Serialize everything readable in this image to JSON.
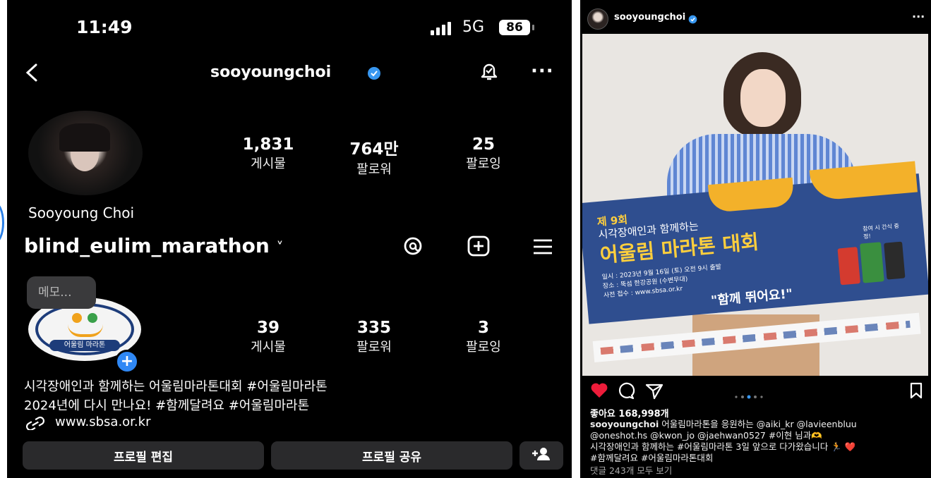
{
  "left": {
    "status": {
      "time": "11:49",
      "network": "5G",
      "battery": "86"
    },
    "header": {
      "username": "sooyoungchoi"
    },
    "profile1": {
      "display_name": "Sooyoung Choi",
      "stats": [
        {
          "value": "1,831",
          "label": "게시물"
        },
        {
          "value": "764만",
          "label": "팔로워"
        },
        {
          "value": "25",
          "label": "팔로잉"
        }
      ]
    },
    "account_switch": {
      "name": "blind_eulim_marathon",
      "chevron": "˅"
    },
    "memo_bubble": "메모...",
    "profile2": {
      "logo_text": "어울림 마라톤",
      "stats": [
        {
          "value": "39",
          "label": "게시물"
        },
        {
          "value": "335",
          "label": "팔로워"
        },
        {
          "value": "3",
          "label": "팔로잉"
        }
      ],
      "bio_line1": "시각장애인과 함께하는 어울림마라톤대회 #어울림마라톤",
      "bio_line2": "2024년에 다시 만나요! #함께달려요 #어울림마라톤",
      "link": "www.sbsa.or.kr"
    },
    "buttons": {
      "edit": "프로필 편집",
      "share": "프로필 공유"
    }
  },
  "right": {
    "username": "sooyoungchoi",
    "more": "···",
    "poster": {
      "edition": "제 9회",
      "subtitle": "시각장애인과 함께하는",
      "title": "어울림 마라톤 대회",
      "date_line": "일시 : 2023년 9월 16일 (토) 오전 9시 출발",
      "place_line": "장소 : 뚝섬 한강공원 (수변무대)",
      "reg_line": "사전 접수 : www.sbsa.or.kr",
      "slogan": "\"함께 뛰어요!\"",
      "gift_note": "참여 시 간식 증정!"
    },
    "likes": "좋아요 168,998개",
    "caption_user": "sooyoungchoi",
    "caption_line1": "어울림마라톤을 응원하는 @aiki_kr @lavieenbluu",
    "caption_line2": "@oneshot.hs @kwon_jo @jaehwan0527 #이현 님과🫶",
    "caption_line3": "시각장애인과 함께하는 #어울림마라톤 3일 앞으로 다가왔습니다 🏃 ❤️",
    "caption_line4": "#함께달려요 #어울림마라톤대회",
    "comments": "댓글 243개 모두 보기"
  }
}
